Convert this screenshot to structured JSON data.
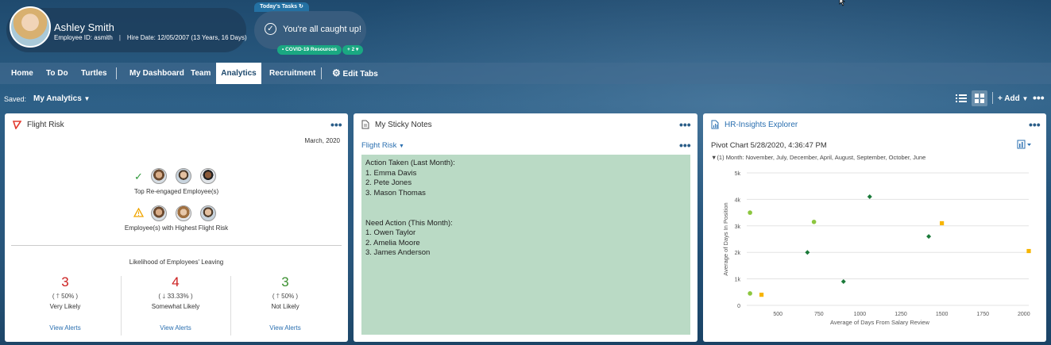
{
  "header": {
    "user_name": "Ashley Smith",
    "employee_id": "Employee ID: asmith",
    "hire_date": "Hire Date: 12/05/2007 (13 Years, 16 Days)",
    "tasks_tab": "Today's Tasks",
    "caught_up": "You're all caught up!",
    "covid_pill": "COVID-19 Resources",
    "more_pill": "+ 2"
  },
  "nav": {
    "items": [
      "Home",
      "To Do",
      "Turtles",
      "My Dashboard",
      "Team",
      "Analytics",
      "Recruitment",
      "Edit Tabs"
    ],
    "active": "Analytics"
  },
  "saved": {
    "label": "Saved:",
    "value": "My Analytics"
  },
  "toolbar": {
    "add_label": "+ Add"
  },
  "flight_risk": {
    "title": "Flight Risk",
    "date": "March, 2020",
    "reengaged_label": "Top Re-engaged Employee(s)",
    "highest_label": "Employee(s) with Highest Flight Risk",
    "likelihood_title": "Likelihood of Employees' Leaving",
    "stats": [
      {
        "value": "3",
        "change": "( 🡑 50% )",
        "label": "Very Likely",
        "link": "View Alerts",
        "color": "#cc1f1f"
      },
      {
        "value": "4",
        "change": "( 🡓 33.33% )",
        "label": "Somewhat Likely",
        "link": "View Alerts",
        "color": "#cc1f1f"
      },
      {
        "value": "3",
        "change": "( 🡑 50% )",
        "label": "Not Likely",
        "link": "View Alerts",
        "color": "#3a8f2f"
      }
    ]
  },
  "sticky_notes": {
    "title": "My Sticky Notes",
    "filter": "Flight Risk",
    "note_color": "#badac5",
    "lines": [
      "Action Taken (Last Month):",
      "1. Emma Davis",
      "2. Pete Jones",
      "3. Mason Thomas",
      "",
      "",
      "Need Action (This Month):",
      "1. Owen Taylor",
      "2. Amelia Moore",
      "3. James Anderson"
    ]
  },
  "hr_insights": {
    "title": "HR-Insights Explorer",
    "subtitle": "Pivot Chart 5/28/2020, 4:36:47 PM",
    "filter": "(1) Month: November, July, December, April, August, September, October, June"
  },
  "chart_data": {
    "type": "scatter",
    "title": "",
    "xlabel": "Average of Days From Salary Review",
    "ylabel": "Average of Days In Position",
    "xlim": [
      310,
      2030
    ],
    "ylim": [
      0,
      5000
    ],
    "x_ticks": [
      500,
      750,
      1000,
      1250,
      1500,
      1750,
      2000
    ],
    "y_ticks": [
      0,
      1000,
      2000,
      3000,
      4000,
      5000
    ],
    "y_tick_labels": [
      "0",
      "1k",
      "2k",
      "3k",
      "4k",
      "5k"
    ],
    "grid": true,
    "series": [
      {
        "color": "#8cc63f",
        "marker": "circle",
        "points": [
          [
            330,
            3500
          ],
          [
            720,
            3150
          ],
          [
            330,
            450
          ]
        ]
      },
      {
        "color": "#1b7a3a",
        "marker": "diamond",
        "points": [
          [
            1060,
            4100
          ],
          [
            680,
            2000
          ],
          [
            1420,
            2600
          ],
          [
            900,
            900
          ]
        ]
      },
      {
        "color": "#f7b500",
        "marker": "square",
        "points": [
          [
            1500,
            3100
          ],
          [
            2030,
            2050
          ],
          [
            400,
            400
          ]
        ]
      }
    ]
  }
}
